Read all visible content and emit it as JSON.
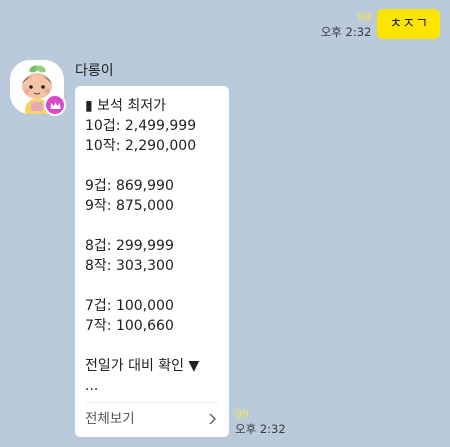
{
  "outgoing": {
    "unread": "99",
    "time": "오후 2:32",
    "text": "ㅊㅈㄱ"
  },
  "incoming": {
    "sender": "다롱이",
    "lines": [
      "▮ 보석 최저가",
      "10겁: 2,499,999",
      "10작: 2,290,000",
      "",
      "9겁: 869,990",
      "9작: 875,000",
      "",
      "8겁: 299,999",
      "8작: 303,300",
      "",
      "7겁: 100,000",
      "7작: 100,660",
      "",
      "전일가 대비 확인 ▼",
      "..."
    ],
    "more_label": "전체보기",
    "unread": "99",
    "time": "오후 2:32"
  },
  "colors": {
    "background": "#b9cadb",
    "outgoing_bubble": "#fee500",
    "unread": "#f5e25a",
    "badge": "#d949c9"
  },
  "icons": {
    "avatar": "character-avatar",
    "badge": "crown-icon",
    "more": "chevron-right-icon"
  }
}
